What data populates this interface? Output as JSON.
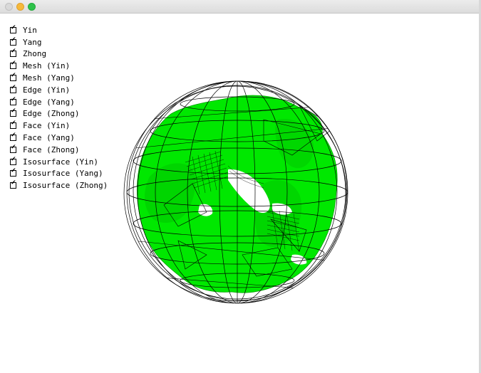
{
  "window": {
    "title": ""
  },
  "controls": {
    "check_glyph": "✔",
    "items": [
      {
        "label": "Yin",
        "checked": true
      },
      {
        "label": "Yang",
        "checked": true
      },
      {
        "label": "Zhong",
        "checked": true
      },
      {
        "label": "Mesh (Yin)",
        "checked": true
      },
      {
        "label": "Mesh (Yang)",
        "checked": true
      },
      {
        "label": "Edge (Yin)",
        "checked": true
      },
      {
        "label": "Edge (Yang)",
        "checked": true
      },
      {
        "label": "Edge (Zhong)",
        "checked": true
      },
      {
        "label": "Face (Yin)",
        "checked": true
      },
      {
        "label": "Face (Yang)",
        "checked": true
      },
      {
        "label": "Face (Zhong)",
        "checked": true
      },
      {
        "label": "Isosurface (Yin)",
        "checked": true
      },
      {
        "label": "Isosurface (Yang)",
        "checked": true
      },
      {
        "label": "Isosurface (Zhong)",
        "checked": true
      }
    ]
  },
  "scene": {
    "isosurface_color": "#00ee00",
    "isosurface_shadow_color": "#00b000",
    "wireframe_color": "#000000",
    "background_color": "#ffffff"
  }
}
